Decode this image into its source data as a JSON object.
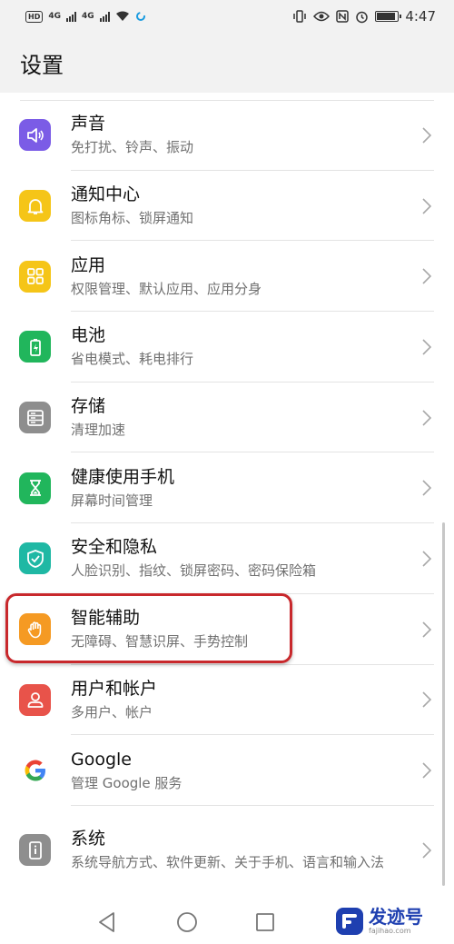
{
  "status_bar": {
    "left_badges": [
      "HD",
      "4G",
      "4G"
    ],
    "time": "4:47",
    "battery_level": 0.9
  },
  "header": {
    "title": "设置"
  },
  "settings": [
    {
      "title": "声音",
      "subtitle": "免打扰、铃声、振动",
      "icon": "speaker-icon",
      "color": "#7b5ce6"
    },
    {
      "title": "通知中心",
      "subtitle": "图标角标、锁屏通知",
      "icon": "bell-icon",
      "color": "#f5c518"
    },
    {
      "title": "应用",
      "subtitle": "权限管理、默认应用、应用分身",
      "icon": "apps-grid-icon",
      "color": "#f5c518"
    },
    {
      "title": "电池",
      "subtitle": "省电模式、耗电排行",
      "icon": "battery-icon",
      "color": "#21b65c"
    },
    {
      "title": "存储",
      "subtitle": "清理加速",
      "icon": "storage-icon",
      "color": "#8e8e8e"
    },
    {
      "title": "健康使用手机",
      "subtitle": "屏幕时间管理",
      "icon": "hourglass-icon",
      "color": "#21b65c"
    },
    {
      "title": "安全和隐私",
      "subtitle": "人脸识别、指纹、锁屏密码、密码保险箱",
      "icon": "shield-icon",
      "color": "#1fb8a4"
    },
    {
      "title": "智能辅助",
      "subtitle": "无障碍、智慧识屏、手势控制",
      "icon": "hand-icon",
      "color": "#f59a23"
    },
    {
      "title": "用户和帐户",
      "subtitle": "多用户、帐户",
      "icon": "user-icon",
      "color": "#e8534a"
    },
    {
      "title": "Google",
      "subtitle": "管理 Google 服务",
      "icon": "google-icon",
      "color": "#ffffff"
    },
    {
      "title": "系统",
      "subtitle": "系统导航方式、软件更新、关于手机、语言和输入法",
      "icon": "phone-info-icon",
      "color": "#8e8e8e"
    }
  ],
  "watermark": {
    "title": "发迹号",
    "url": "fajihao.com"
  }
}
